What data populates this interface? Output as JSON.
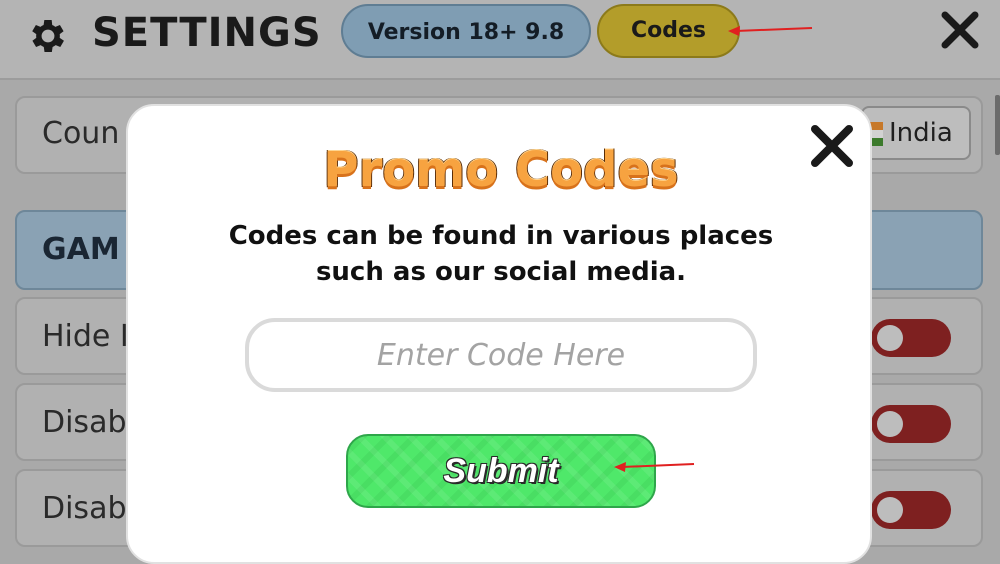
{
  "header": {
    "title": "SETTINGS",
    "version_label": "Version 18+ 9.8",
    "codes_label": "Codes"
  },
  "settings": {
    "country_label": "Coun",
    "country_value": "India",
    "section_title": "GAM",
    "rows": [
      {
        "label": "Hide I",
        "enabled": false
      },
      {
        "label": "Disab",
        "enabled": false
      },
      {
        "label": "Disab",
        "enabled": false
      }
    ]
  },
  "modal": {
    "title": "Promo Codes",
    "description_line1": "Codes can be found in various places",
    "description_line2": "such as our social media.",
    "input_placeholder": "Enter Code Here",
    "input_value": "",
    "submit_label": "Submit"
  },
  "colors": {
    "accent_orange": "#f7a340",
    "submit_green": "#4fe86a",
    "annotation_red": "#e02020",
    "toggle_off": "#c0392b"
  },
  "icons": [
    "gear-icon",
    "close-icon",
    "flag-icon",
    "arrow-annotation"
  ]
}
